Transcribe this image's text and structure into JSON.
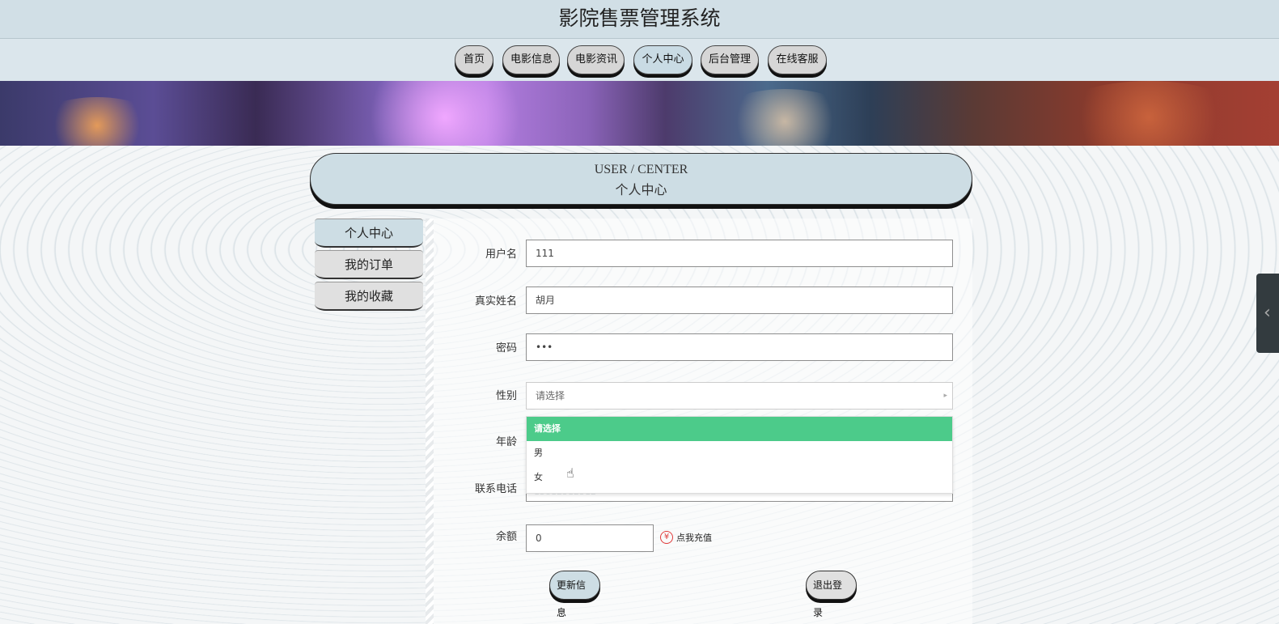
{
  "header": {
    "title": "影院售票管理系统"
  },
  "nav": {
    "items": [
      {
        "label": "首页"
      },
      {
        "label": "电影信息"
      },
      {
        "label": "电影资讯"
      },
      {
        "label": "个人中心"
      },
      {
        "label": "后台管理"
      },
      {
        "label": "在线客服"
      }
    ]
  },
  "section_header": {
    "en": "USER / CENTER",
    "cn": "个人中心"
  },
  "left_menu": {
    "items": [
      {
        "label": "个人中心"
      },
      {
        "label": "我的订单"
      },
      {
        "label": "我的收藏"
      }
    ]
  },
  "form": {
    "username": {
      "label": "用户名",
      "value": "111"
    },
    "realname": {
      "label": "真实姓名",
      "value": "胡月"
    },
    "password": {
      "label": "密码",
      "value": "•••"
    },
    "gender": {
      "label": "性别",
      "placeholder": "请选择",
      "options": [
        {
          "label": "请选择"
        },
        {
          "label": "男"
        },
        {
          "label": "女"
        }
      ]
    },
    "age": {
      "label": "年龄"
    },
    "phone": {
      "label": "联系电话",
      "value": "13812312312"
    },
    "balance": {
      "label": "余额",
      "value": "0"
    },
    "recharge_label": "点我充值"
  },
  "actions": {
    "update": "更新信息",
    "logout": "退出登录"
  },
  "colors": {
    "accent_green": "#4ccb8a",
    "header_bg": "#d1dfe6",
    "recharge_red": "#e03a3a"
  }
}
